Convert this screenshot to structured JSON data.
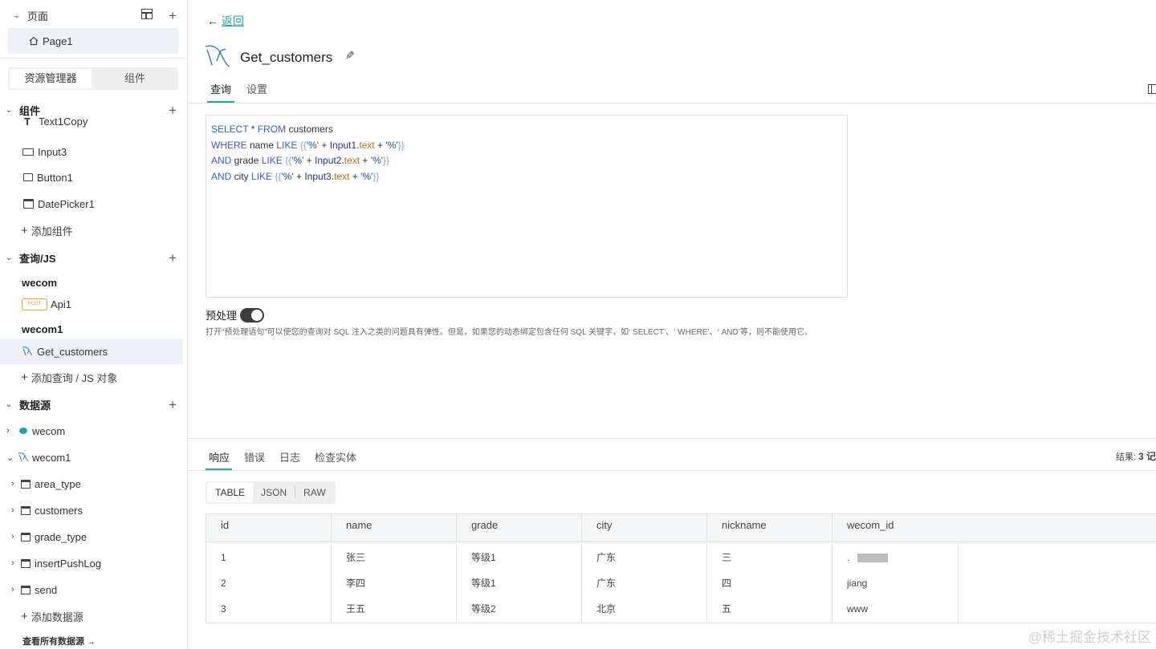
{
  "sidebar": {
    "pages_section": {
      "title": "页面",
      "items": [
        "Page1"
      ]
    },
    "switcher": {
      "explorer": "资源管理器",
      "widgets": "组件"
    },
    "components_section": {
      "title": "组件",
      "items": [
        "Text1Copy",
        "Input3",
        "Button1",
        "DatePicker1"
      ],
      "add_label": "添加组件"
    },
    "queries_section": {
      "title": "查询/JS",
      "groups": [
        {
          "name": "wecom",
          "items": [
            {
              "badge": "POST",
              "label": "Api1"
            }
          ]
        },
        {
          "name": "wecom1",
          "items": [
            {
              "label": "Get_customers"
            }
          ]
        }
      ],
      "add_label": "添加查询 / JS 对象"
    },
    "datasources_section": {
      "title": "数据源",
      "sources": [
        "wecom",
        "wecom1"
      ],
      "tables": [
        "area_type",
        "customers",
        "grade_type",
        "insertPushLog",
        "send"
      ],
      "add_label": "添加数据源",
      "view_all": "查看所有数据源 →"
    }
  },
  "main": {
    "back_label": "返回",
    "query_name": "Get_customers",
    "tabs": [
      "查询",
      "设置"
    ],
    "sql_lines": [
      [
        [
          "kw",
          "SELECT"
        ],
        [
          "t",
          " * "
        ],
        [
          "kw",
          "FROM"
        ],
        [
          "t",
          " customers"
        ]
      ],
      [
        [
          "kw",
          "WHERE"
        ],
        [
          "t",
          " name "
        ],
        [
          "kw",
          "LIKE"
        ],
        [
          "t",
          " "
        ],
        [
          "br",
          "{{"
        ],
        [
          "str",
          "'%'"
        ],
        [
          "t",
          " + "
        ],
        [
          "var",
          "Input1"
        ],
        [
          "t",
          "."
        ],
        [
          "prop",
          "text"
        ],
        [
          "t",
          " + "
        ],
        [
          "str",
          "'%'"
        ],
        [
          "br",
          "}}"
        ]
      ],
      [
        [
          "kw",
          "AND"
        ],
        [
          "t",
          " grade "
        ],
        [
          "kw",
          "LIKE"
        ],
        [
          "t",
          " "
        ],
        [
          "br",
          "{{"
        ],
        [
          "str",
          "'%'"
        ],
        [
          "t",
          " + "
        ],
        [
          "var",
          "Input2"
        ],
        [
          "t",
          "."
        ],
        [
          "prop",
          "text"
        ],
        [
          "t",
          " + "
        ],
        [
          "str",
          "'%'"
        ],
        [
          "br",
          "}}"
        ]
      ],
      [
        [
          "kw",
          "AND"
        ],
        [
          "t",
          " city "
        ],
        [
          "kw",
          "LIKE"
        ],
        [
          "t",
          " "
        ],
        [
          "br",
          "{{"
        ],
        [
          "str",
          "'%'"
        ],
        [
          "t",
          " + "
        ],
        [
          "var",
          "Input3"
        ],
        [
          "t",
          "."
        ],
        [
          "prop",
          "text"
        ],
        [
          "t",
          " + "
        ],
        [
          "str",
          "'%'"
        ],
        [
          "br",
          "}}"
        ]
      ]
    ],
    "prepared_label": "预处理",
    "prepared_enabled": true,
    "prepared_desc": "打开“预处理语句”可以使您的查询对 SQL 注入之类的问题具有弹性。但是，如果您的动态绑定包含任何 SQL 关键字，如‘ SELECT’、‘ WHERE’、‘ AND’等，则不能使用它。"
  },
  "response": {
    "tabs": [
      "响应",
      "错误",
      "日志",
      "检查实体"
    ],
    "result_label": "结果:",
    "result_value": "3 记",
    "formats": [
      "TABLE",
      "JSON",
      "RAW"
    ],
    "columns": [
      "id",
      "name",
      "grade",
      "city",
      "nickname",
      "wecom_id"
    ],
    "rows": [
      [
        "1",
        "张三",
        "等级1",
        "广东",
        "三",
        "."
      ],
      [
        "2",
        "李四",
        "等级1",
        "广东",
        "四",
        "jiang"
      ],
      [
        "3",
        "王五",
        "等级2",
        "北京",
        "五",
        "www"
      ]
    ]
  },
  "watermark": "@稀土掘金技术社区",
  "colors": {
    "accent": "#1fa89c",
    "keyword": "#3b5bd6",
    "post_badge": "#e8a13a"
  }
}
